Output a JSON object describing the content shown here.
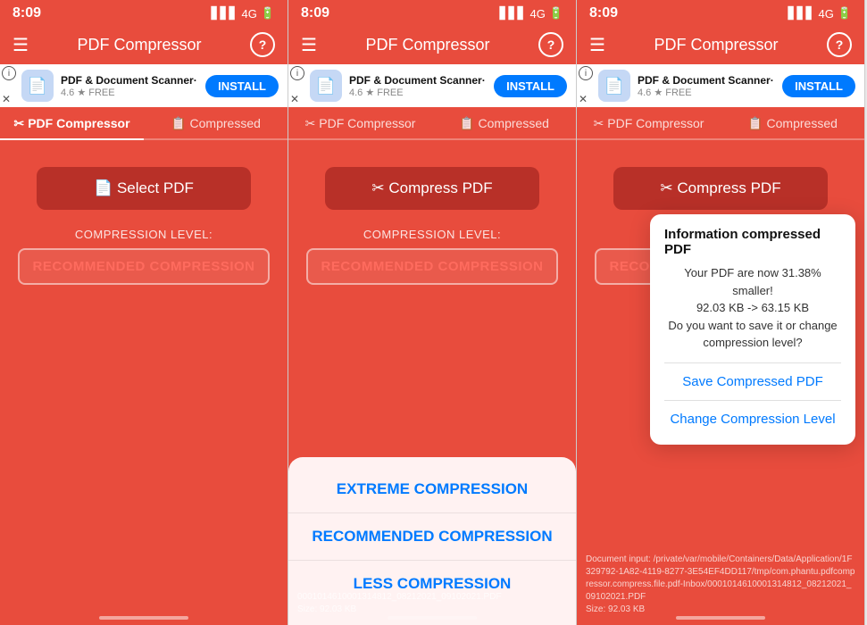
{
  "panels": [
    {
      "id": "panel1",
      "statusTime": "8:09",
      "statusSignal": "▋▋▋",
      "statusNetwork": "4G",
      "headerTitle": "PDF Compressor",
      "adAppName": "PDF & Document Scanner·",
      "adStars": "4.6 ★  FREE",
      "adInstallLabel": "INSTALL",
      "tabs": [
        {
          "label": "PDF Compressor",
          "icon": "✂",
          "active": true
        },
        {
          "label": "Compressed",
          "icon": "📋",
          "active": false
        }
      ],
      "mainButton": "📄 Select PDF",
      "compressionLevelLabel": "COMPRESSION LEVEL:",
      "compressionValue": "RECOMMENDED COMPRESSION",
      "showOptions": false,
      "showInfoPopup": false
    },
    {
      "id": "panel2",
      "statusTime": "8:09",
      "statusSignal": "▋▋▋",
      "statusNetwork": "4G",
      "headerTitle": "PDF Compressor",
      "adAppName": "PDF & Document Scanner·",
      "adStars": "4.6 ★  FREE",
      "adInstallLabel": "INSTALL",
      "tabs": [
        {
          "label": "PDF Compressor",
          "icon": "✂",
          "active": false
        },
        {
          "label": "Compressed",
          "icon": "📋",
          "active": false
        }
      ],
      "mainButton": "✂ Compress PDF",
      "compressionLevelLabel": "COMPRESSION LEVEL:",
      "compressionValue": "RECOMMENDED COMPRESSION",
      "showOptions": true,
      "options": [
        "EXTREME COMPRESSION",
        "RECOMMENDED COMPRESSION",
        "LESS COMPRESSION"
      ],
      "fileInfo": "0001014610001314812_08212021_09102021.PDF\nSize: 92.03 KB",
      "showInfoPopup": false
    },
    {
      "id": "panel3",
      "statusTime": "8:09",
      "statusSignal": "▋▋▋",
      "statusNetwork": "4G",
      "headerTitle": "PDF Compressor",
      "adAppName": "PDF & Document Scanner·",
      "adStars": "4.6 ★  FREE",
      "adInstallLabel": "INSTALL",
      "tabs": [
        {
          "label": "PDF Compressor",
          "icon": "✂",
          "active": false
        },
        {
          "label": "Compressed",
          "icon": "📋",
          "active": false
        }
      ],
      "mainButton": "✂ Compress PDF",
      "compressionLevelLabel": "COMPRESSION LEVEL:",
      "compressionValue": "RECOMMENDED COMPRESSION",
      "showOptions": false,
      "showInfoPopup": true,
      "infoPopup": {
        "title": "Information compressed PDF",
        "body": "Your PDF are now 31.38% smaller!\n92.03 KB -> 63.15 KB\nDo you want to save it or change compression level?",
        "saveLabel": "Save Compressed PDF",
        "changeLabel": "Change Compression Level"
      },
      "fileInfo": "Document input: /private/var/mobile/Containers/Data/Application/1F329792-1A82-4119-8277-3E54EF4DD117/tmp/com.phantu.pdfcompressor.compress.file.pdf-Inbox/0001014610001314812_08212021_09102021.PDF\nSize: 92.03 KB"
    }
  ]
}
